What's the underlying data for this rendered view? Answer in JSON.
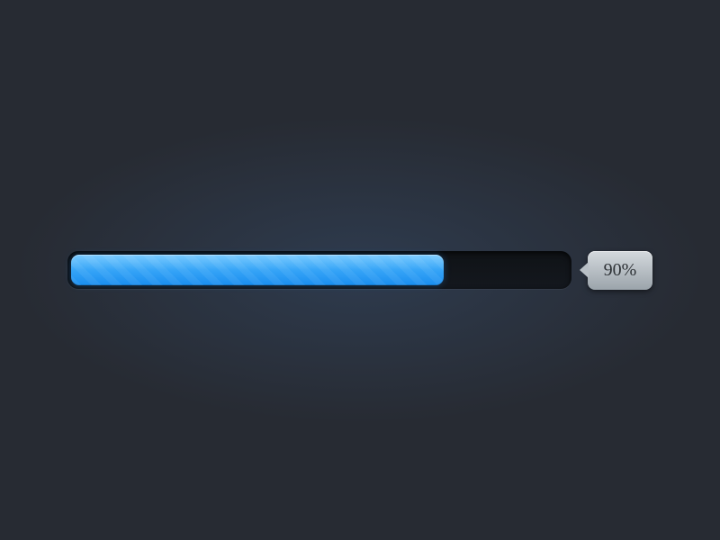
{
  "progress": {
    "percent": 75,
    "label": "90%"
  }
}
